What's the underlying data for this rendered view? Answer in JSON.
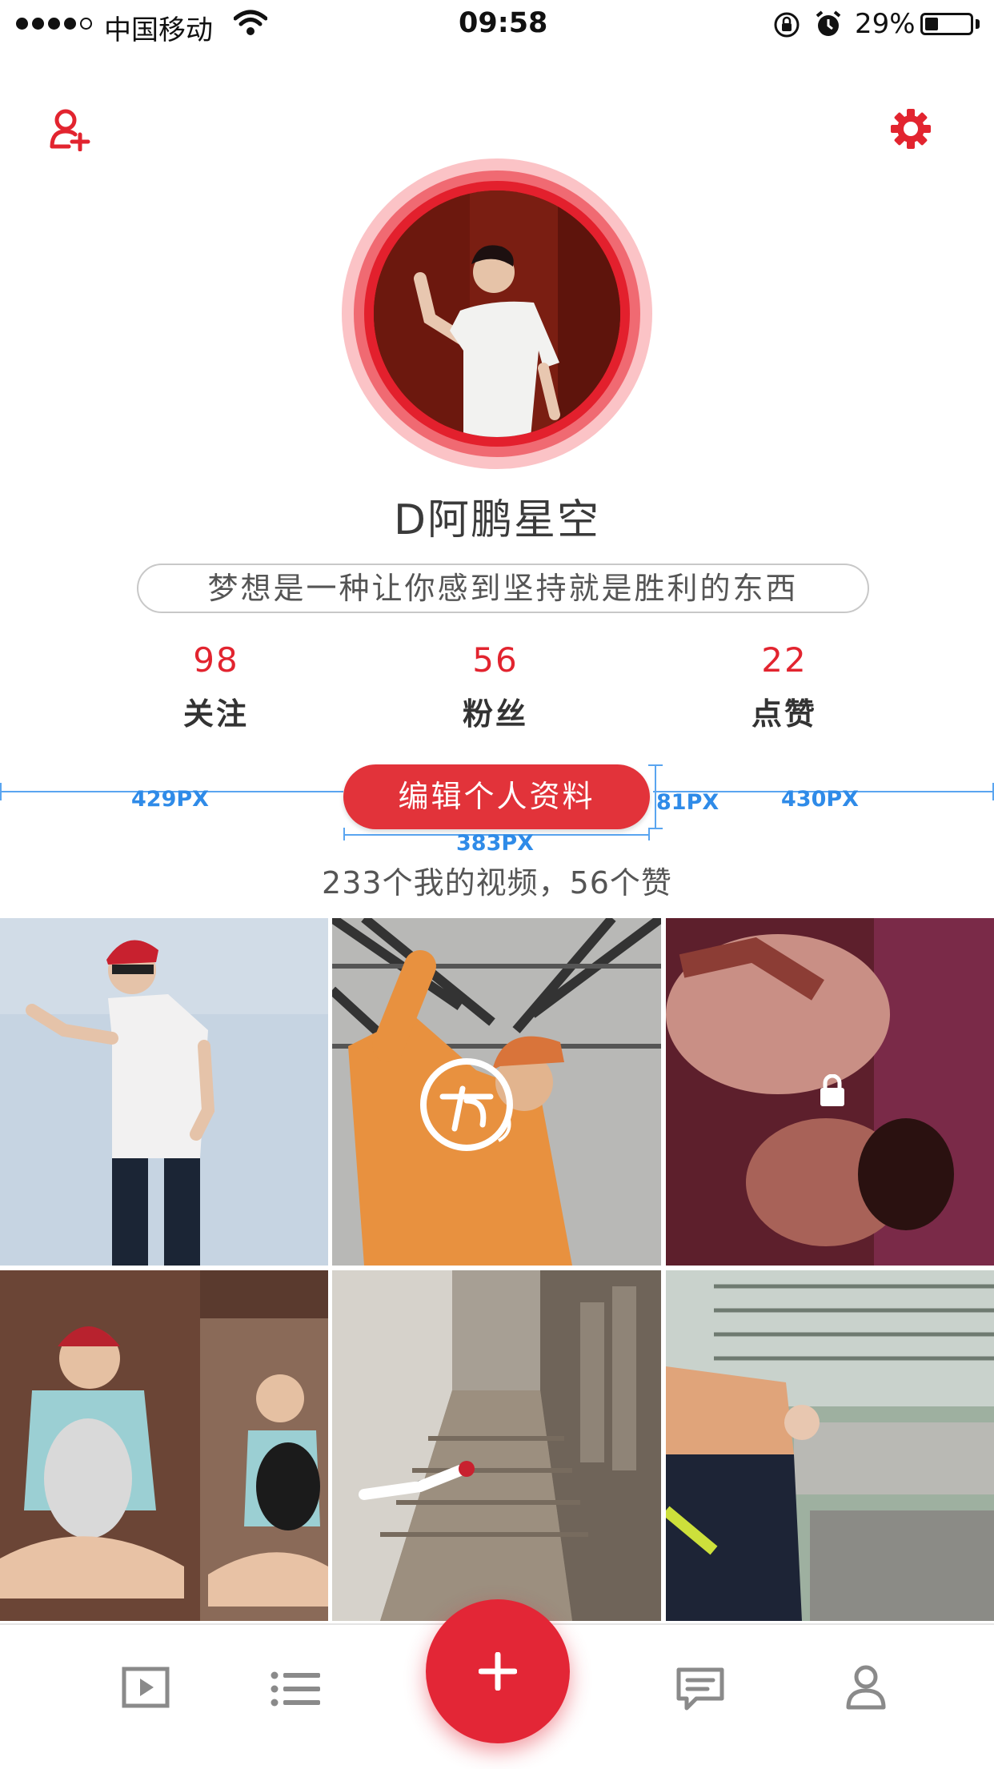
{
  "status_bar": {
    "carrier": "中国移动",
    "time": "09:58",
    "battery_percent_text": "29%",
    "battery_level": 0.29,
    "signal_bars_filled": 4,
    "icons": [
      "wifi-icon",
      "orientation-lock-icon",
      "alarm-icon"
    ]
  },
  "header": {
    "left_icon": "add-friend-icon",
    "right_icon": "settings-gear-icon",
    "accent_color": "#e2242f"
  },
  "profile": {
    "username": "D阿鹏星空",
    "motto": "梦想是一种让你感到坚持就是胜利的东西",
    "stats": [
      {
        "value": "98",
        "label": "关注"
      },
      {
        "value": "56",
        "label": "粉丝"
      },
      {
        "value": "22",
        "label": "点赞"
      }
    ],
    "edit_button_label": "编辑个人资料",
    "summary": "233个我的视频，56个赞"
  },
  "annotations": {
    "left": "429PX",
    "right": "430PX",
    "height": "81PX",
    "width": "383PX"
  },
  "videos": [
    {
      "name": "video-1",
      "overlay": ""
    },
    {
      "name": "video-2",
      "overlay": "loading-spinner-icon"
    },
    {
      "name": "video-3",
      "overlay": "lock-icon"
    },
    {
      "name": "video-4",
      "overlay": ""
    },
    {
      "name": "video-5",
      "overlay": ""
    },
    {
      "name": "video-6",
      "overlay": ""
    }
  ],
  "tab_bar": {
    "tabs": [
      "video-play-icon",
      "list-icon",
      "add-icon",
      "message-icon",
      "profile-icon"
    ]
  }
}
